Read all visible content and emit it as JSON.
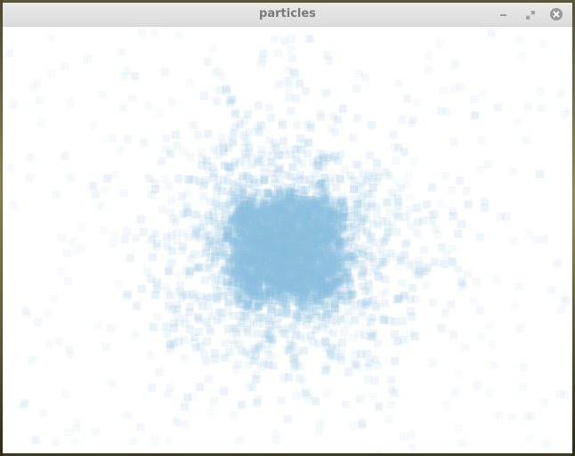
{
  "window": {
    "title": "particles",
    "controls": {
      "minimize_icon": "minimize-icon",
      "maximize_icon": "maximize-icon",
      "close_icon": "close-icon"
    }
  },
  "canvas": {
    "background_color": "#ffffff",
    "particle_color": "#8cc0e0",
    "particle_shape": "square"
  }
}
